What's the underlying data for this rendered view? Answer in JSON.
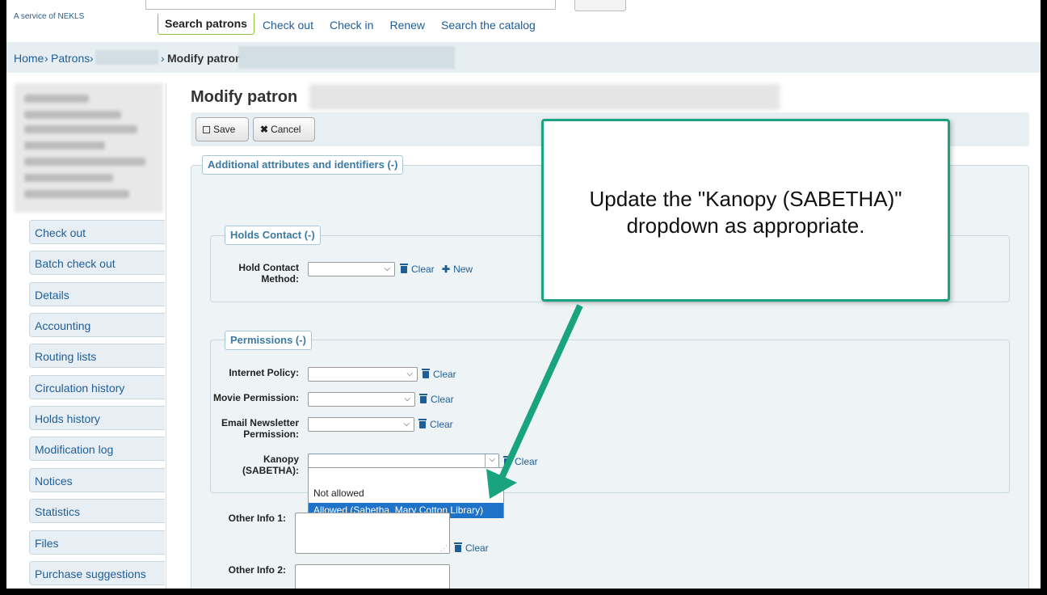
{
  "header": {
    "service_text": "A service of NEKLS",
    "tabs": [
      "Search patrons",
      "Check out",
      "Check in",
      "Renew",
      "Search the catalog"
    ]
  },
  "breadcrumb": {
    "home": "Home",
    "patrons": "Patrons",
    "current": "Modify patron"
  },
  "sidebar": {
    "items": [
      "Check out",
      "Batch check out",
      "Details",
      "Accounting",
      "Routing lists",
      "Circulation history",
      "Holds history",
      "Modification log",
      "Notices",
      "Statistics",
      "Files",
      "Purchase suggestions"
    ]
  },
  "main": {
    "title": "Modify patron",
    "toolbar": {
      "save_label": "Save",
      "cancel_label": "Cancel"
    },
    "attributes_legend": "Additional attributes and identifiers (-)",
    "holds_contact": {
      "legend": "Holds Contact (-)",
      "field_label": "Hold Contact Method:",
      "clear_label": "Clear",
      "new_label": "New"
    },
    "permissions": {
      "legend": "Permissions (-)",
      "fields": [
        {
          "label": "Internet Policy:",
          "clear": "Clear"
        },
        {
          "label": "Movie Permission:",
          "clear": "Clear"
        },
        {
          "label": "Email Newsletter Permission:",
          "clear": "Clear"
        },
        {
          "label": "Kanopy (SABETHA):",
          "clear": "Clear"
        }
      ],
      "kanopy_options": [
        "",
        "Not allowed",
        "Allowed (Sabetha, Mary Cotton Library)"
      ],
      "kanopy_highlighted": "Allowed (Sabetha, Mary Cotton Library)"
    },
    "other_info": [
      {
        "label": "Other Info 1:",
        "clear": "Clear"
      },
      {
        "label": "Other Info 2:"
      }
    ]
  },
  "callout": {
    "text": "Update the \"Kanopy (SABETHA)\" dropdown as appropriate.",
    "border_color": "#1aa37f"
  },
  "colors": {
    "link": "#1f5d96",
    "active_tab_border": "#8fbf3f",
    "dropdown_highlight": "#1e73c8"
  }
}
